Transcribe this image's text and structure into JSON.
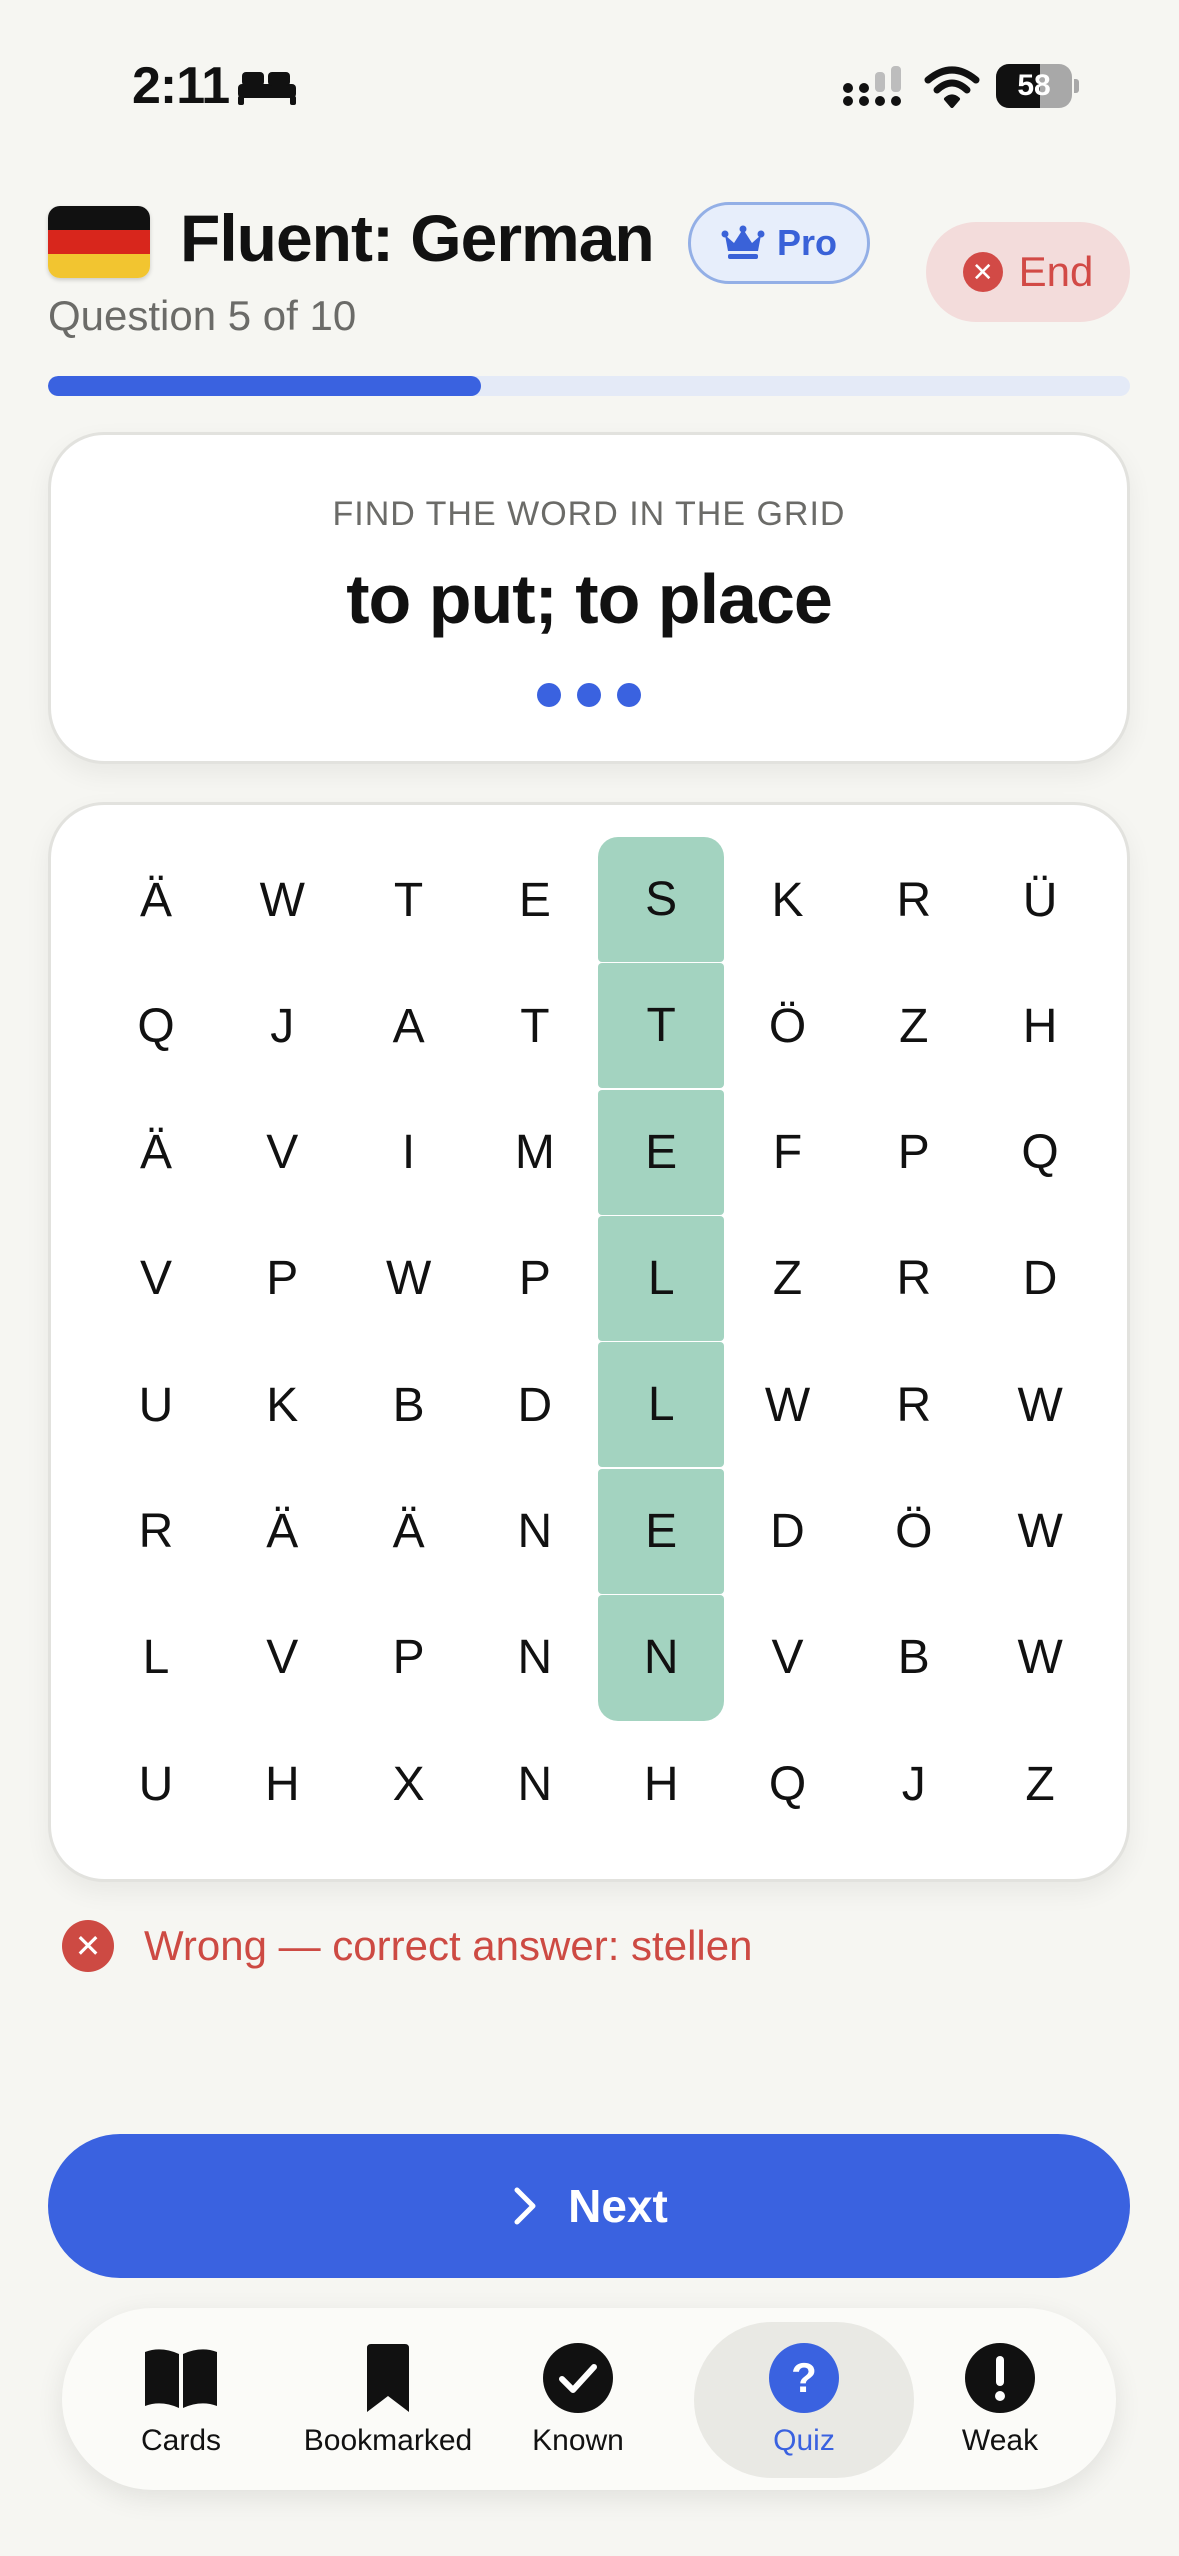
{
  "status_bar": {
    "time": "2:11",
    "battery": "58",
    "battery_percent": 58
  },
  "header": {
    "title": "Fluent: German",
    "pro_label": "Pro",
    "end_label": "End",
    "question_counter": "Question 5 of 10",
    "progress_fraction": 0.4
  },
  "prompt": {
    "instruction": "FIND THE WORD IN THE GRID",
    "word": "to put; to place"
  },
  "grid": {
    "rows": [
      [
        "Ä",
        "W",
        "T",
        "E",
        "S",
        "K",
        "R",
        "Ü"
      ],
      [
        "Q",
        "J",
        "A",
        "T",
        "T",
        "Ö",
        "Z",
        "H"
      ],
      [
        "Ä",
        "V",
        "I",
        "M",
        "E",
        "F",
        "P",
        "Q"
      ],
      [
        "V",
        "P",
        "W",
        "P",
        "L",
        "Z",
        "R",
        "D"
      ],
      [
        "U",
        "K",
        "B",
        "D",
        "L",
        "W",
        "R",
        "W"
      ],
      [
        "R",
        "Ä",
        "Ä",
        "N",
        "E",
        "D",
        "Ö",
        "W"
      ],
      [
        "L",
        "V",
        "P",
        "N",
        "N",
        "V",
        "B",
        "W"
      ],
      [
        "U",
        "H",
        "X",
        "N",
        "H",
        "Q",
        "J",
        "Z"
      ]
    ],
    "highlighted_column": 4,
    "highlighted_rows": [
      0,
      1,
      2,
      3,
      4,
      5,
      6
    ],
    "highlight_color": "#a3d3c0"
  },
  "feedback": {
    "text": "Wrong — correct answer: stellen"
  },
  "next_button": {
    "label": "Next"
  },
  "tabs": [
    {
      "label": "Cards",
      "icon": "book-icon",
      "active": false
    },
    {
      "label": "Bookmarked",
      "icon": "bookmark-icon",
      "active": false
    },
    {
      "label": "Known",
      "icon": "checkmark-circle-icon",
      "active": false
    },
    {
      "label": "Quiz",
      "icon": "question-circle-icon",
      "active": true
    },
    {
      "label": "Weak",
      "icon": "exclamation-circle-icon",
      "active": false
    }
  ],
  "colors": {
    "accent": "#3a62e0",
    "error": "#cd4a43",
    "flag_black": "#111111",
    "flag_red": "#d8261c",
    "flag_gold": "#f2c530"
  }
}
